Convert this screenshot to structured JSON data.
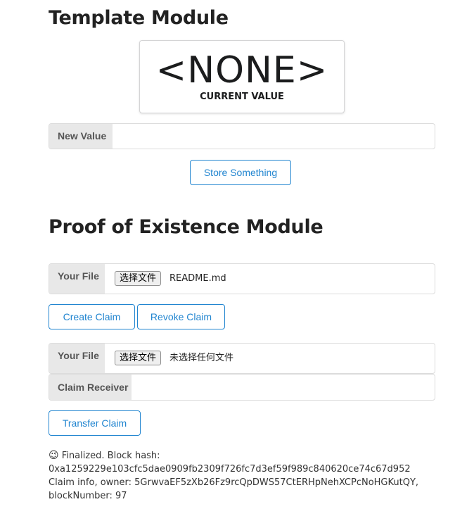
{
  "template_module": {
    "title": "Template Module",
    "current_value": "<NONE>",
    "current_value_label": "CURRENT VALUE",
    "new_value_label": "New Value",
    "new_value_input": "",
    "store_button": "Store Something"
  },
  "poe_module": {
    "title": "Proof of Existence Module",
    "claim_file": {
      "label": "Your File",
      "choose_button": "选择文件",
      "file_name": "README.md"
    },
    "create_button": "Create Claim",
    "revoke_button": "Revoke Claim",
    "transfer_file": {
      "label": "Your File",
      "choose_button": "选择文件",
      "file_name": "未选择任何文件"
    },
    "receiver_label": "Claim Receiver",
    "receiver_input": "",
    "transfer_button": "Transfer Claim"
  },
  "status": {
    "emoji": "😉",
    "line1": "Finalized. Block hash:",
    "line2": "0xa1259229e103cfc5dae0909fb2309f726fc7d3ef59f989c840620ce74c67d952",
    "line3": "Claim info, owner: 5GrwvaEF5zXb26Fz9rcQpDWS57CtERHpNehXCPcNoHGKutQY,",
    "line4": "blockNumber: 97"
  },
  "colors": {
    "accent": "#2185d0",
    "label_bg": "#e8e8e8"
  }
}
